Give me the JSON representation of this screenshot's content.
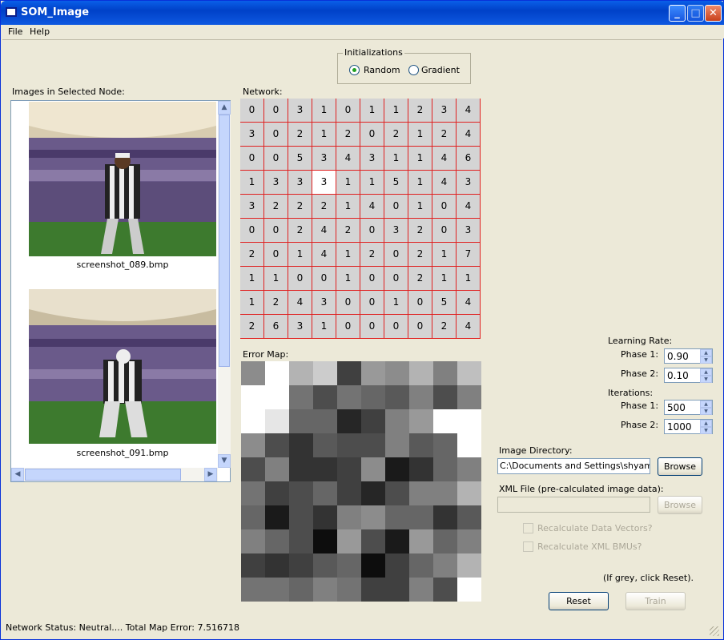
{
  "window": {
    "title": "SOM_Image"
  },
  "menu": [
    "File",
    "Help"
  ],
  "init": {
    "title": "Initializations",
    "options": [
      "Random",
      "Gradient"
    ],
    "selected": "Random"
  },
  "list": {
    "label": "Images in Selected Node:",
    "items": [
      {
        "caption": "screenshot_089.bmp",
        "icon": "referee-in-stadium-image"
      },
      {
        "caption": "screenshot_091.bmp",
        "icon": "referee-in-stadium-image"
      }
    ]
  },
  "network": {
    "label": "Network:",
    "grid": [
      [
        0,
        0,
        3,
        1,
        0,
        1,
        1,
        2,
        3,
        4
      ],
      [
        3,
        0,
        2,
        1,
        2,
        0,
        2,
        1,
        2,
        4
      ],
      [
        0,
        0,
        5,
        3,
        4,
        3,
        1,
        1,
        4,
        6
      ],
      [
        1,
        3,
        3,
        3,
        1,
        1,
        5,
        1,
        4,
        3
      ],
      [
        3,
        2,
        2,
        2,
        1,
        4,
        0,
        1,
        0,
        4
      ],
      [
        0,
        0,
        2,
        4,
        2,
        0,
        3,
        2,
        0,
        3
      ],
      [
        2,
        0,
        1,
        4,
        1,
        2,
        0,
        2,
        1,
        7
      ],
      [
        1,
        1,
        0,
        0,
        1,
        0,
        0,
        2,
        1,
        1
      ],
      [
        1,
        2,
        4,
        3,
        0,
        0,
        1,
        0,
        5,
        4
      ],
      [
        2,
        6,
        3,
        1,
        0,
        0,
        0,
        0,
        2,
        4
      ]
    ],
    "selected": {
      "row": 3,
      "col": 3
    }
  },
  "error_map": {
    "label": "Error Map:",
    "gray": [
      [
        0.55,
        1.0,
        0.7,
        0.8,
        0.25,
        0.6,
        0.55,
        0.7,
        0.5,
        0.75
      ],
      [
        1.0,
        1.0,
        0.45,
        0.3,
        0.45,
        0.4,
        0.35,
        0.5,
        0.3,
        0.5
      ],
      [
        1.0,
        0.9,
        0.4,
        0.4,
        0.15,
        0.25,
        0.5,
        0.6,
        1.0,
        1.0
      ],
      [
        0.55,
        0.3,
        0.2,
        0.35,
        0.3,
        0.3,
        0.5,
        0.35,
        0.4,
        1.0
      ],
      [
        0.3,
        0.5,
        0.2,
        0.2,
        0.25,
        0.55,
        0.1,
        0.2,
        0.4,
        0.5
      ],
      [
        0.45,
        0.25,
        0.3,
        0.4,
        0.25,
        0.15,
        0.3,
        0.5,
        0.5,
        0.7
      ],
      [
        0.4,
        0.1,
        0.3,
        0.2,
        0.5,
        0.55,
        0.4,
        0.4,
        0.2,
        0.35
      ],
      [
        0.5,
        0.4,
        0.3,
        0.05,
        0.6,
        0.3,
        0.1,
        0.6,
        0.4,
        0.5
      ],
      [
        0.25,
        0.2,
        0.25,
        0.35,
        0.4,
        0.05,
        0.25,
        0.4,
        0.5,
        0.7
      ],
      [
        0.45,
        0.45,
        0.4,
        0.5,
        0.45,
        0.25,
        0.25,
        0.5,
        0.3,
        1.0
      ]
    ]
  },
  "learning_rate": {
    "label": "Learning Rate:",
    "phase1_label": "Phase 1:",
    "phase1": "0.90",
    "phase2_label": "Phase 2:",
    "phase2": "0.10"
  },
  "iterations": {
    "label": "Iterations:",
    "phase1_label": "Phase 1:",
    "phase1": "500",
    "phase2_label": "Phase 2:",
    "phase2": "1000"
  },
  "image_dir": {
    "label": "Image Directory:",
    "value": "C:\\Documents and Settings\\shyam\\De",
    "browse": "Browse"
  },
  "xml_file": {
    "label": "XML File (pre-calculated image data):",
    "value": "",
    "browse": "Browse"
  },
  "options": {
    "recalc_vectors": "Recalculate Data Vectors?",
    "recalc_bmus": "Recalculate XML BMUs?"
  },
  "hint": "(If grey, click Reset).",
  "buttons": {
    "reset": "Reset",
    "train": "Train"
  },
  "status": "Network Status: Neutral.... Total Map Error: 7.516718"
}
